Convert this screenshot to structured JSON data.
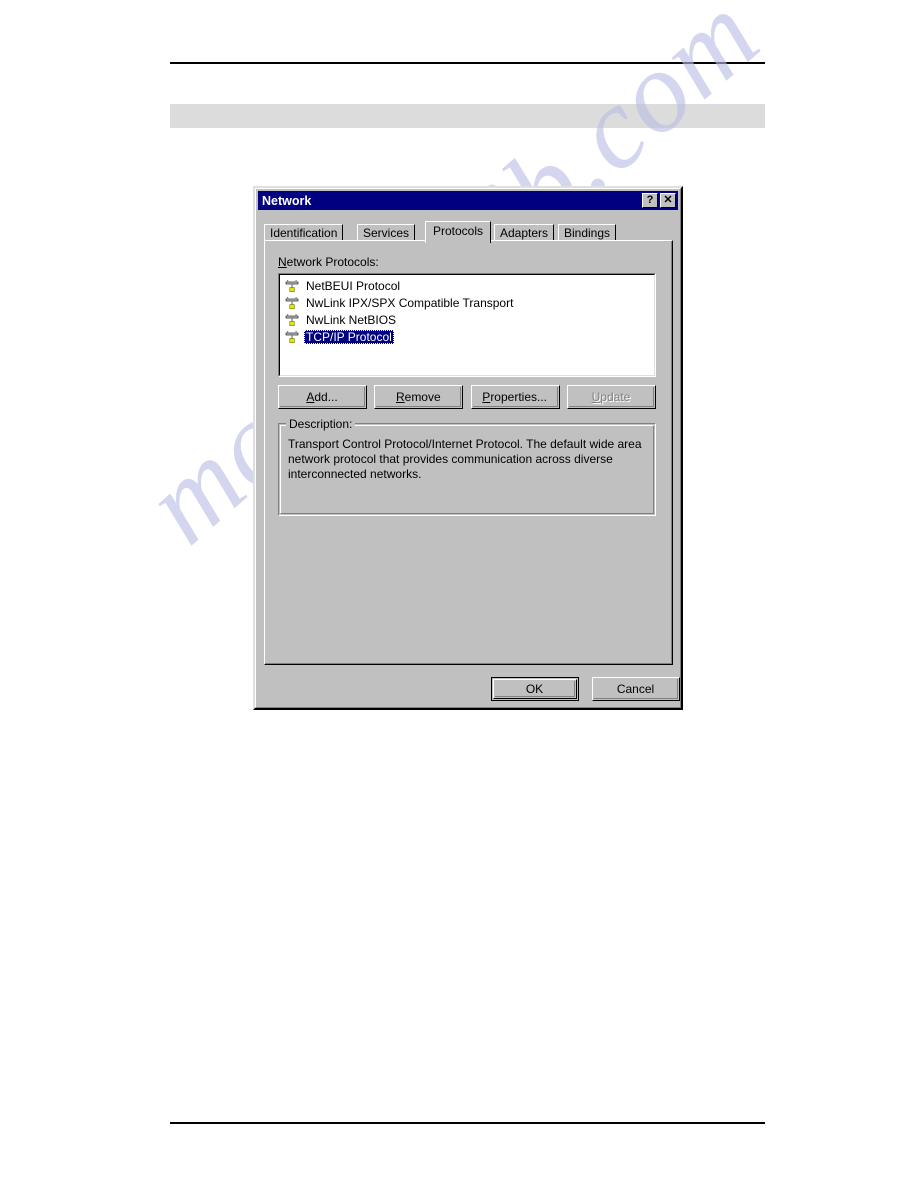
{
  "page": {
    "background_color": "#ffffff",
    "header_rule_color": "#000000",
    "band_color": "#dcdcdc",
    "watermark_text": "manualslib.com",
    "watermark_color": "#b9bee4"
  },
  "dialog": {
    "title": "Network",
    "title_bar_color": "#000080",
    "face_color": "#c0c0c0",
    "titlebar_buttons": [
      {
        "name": "help",
        "glyph": "?"
      },
      {
        "name": "close",
        "glyph": "✕"
      }
    ],
    "tabs": [
      {
        "label": "Identification",
        "active": false
      },
      {
        "label": "Services",
        "active": false
      },
      {
        "label": "Protocols",
        "active": true
      },
      {
        "label": "Adapters",
        "active": false
      },
      {
        "label": "Bindings",
        "active": false
      }
    ],
    "list_label": {
      "accelerator": "N",
      "rest": "etwork Protocols:"
    },
    "protocols": [
      {
        "label": "NetBEUI Protocol",
        "selected": false
      },
      {
        "label": "NwLink IPX/SPX Compatible Transport",
        "selected": false
      },
      {
        "label": "NwLink NetBIOS",
        "selected": false
      },
      {
        "label": "TCP/IP Protocol",
        "selected": true
      }
    ],
    "selection_color": "#000080",
    "action_buttons": [
      {
        "accelerator": "A",
        "rest": "dd...",
        "enabled": true
      },
      {
        "accelerator": "R",
        "rest": "emove",
        "enabled": true
      },
      {
        "accelerator": "P",
        "rest": "roperties...",
        "enabled": true
      },
      {
        "accelerator": "U",
        "rest": "pdate",
        "enabled": false
      }
    ],
    "description": {
      "title": "Description:",
      "text": "Transport Control Protocol/Internet Protocol. The default wide area network protocol that provides communication across diverse interconnected networks."
    },
    "ok_label": "OK",
    "cancel_label": "Cancel"
  }
}
